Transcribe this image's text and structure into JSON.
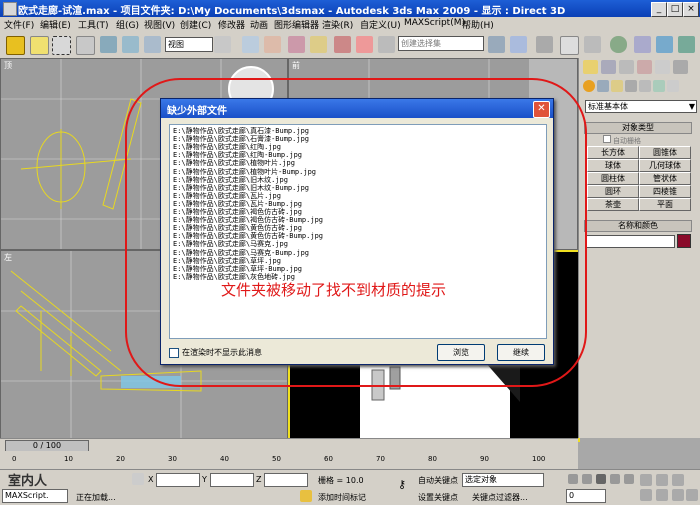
{
  "window": {
    "title": "欧式走廊-试渲.max    - 项目文件夹: D:\\My Documents\\3dsmax    - Autodesk 3ds Max  2009    - 显示 : Direct 3D"
  },
  "menu": [
    "文件(F)",
    "编辑(E)",
    "工具(T)",
    "组(G)",
    "视图(V)",
    "创建(C)",
    "修改器",
    "动画",
    "图形编辑器",
    "渲染(R)",
    "自定义(U)",
    "MAXScript(M)",
    "帮助(H)"
  ],
  "toolbar": {
    "view_dropdown": "视图",
    "selection_set_placeholder": "创建选择集"
  },
  "viewports": {
    "top": "顶",
    "front": "前",
    "left": "左"
  },
  "command_panel": {
    "category": "标准基本体",
    "rollout_object_type": "对象类型",
    "autogrid": "自动栅格",
    "buttons": [
      "长方体",
      "圆锥体",
      "球体",
      "几何球体",
      "圆柱体",
      "管状体",
      "圆环",
      "四棱锥",
      "茶壶",
      "平面"
    ],
    "rollout_name_color": "名称和颜色",
    "object_color": "#8a0a2a"
  },
  "dialog": {
    "title": "缺少外部文件",
    "close": "✕",
    "files": [
      "E:\\静物作品\\欧式走廊\\真石漆-Bump.jpg",
      "E:\\静物作品\\欧式走廊\\石膏漆-Bump.jpg",
      "E:\\静物作品\\欧式走廊\\红陶.jpg",
      "E:\\静物作品\\欧式走廊\\红陶-Bump.jpg",
      "E:\\静物作品\\欧式走廊\\植物叶片.jpg",
      "E:\\静物作品\\欧式走廊\\植物叶片-Bump.jpg",
      "E:\\静物作品\\欧式走廊\\旧木纹.jpg",
      "E:\\静物作品\\欧式走廊\\旧木纹-Bump.jpg",
      "E:\\静物作品\\欧式走廊\\瓦片.jpg",
      "E:\\静物作品\\欧式走廊\\瓦片-Bump.jpg",
      "E:\\静物作品\\欧式走廊\\褐色仿古砖.jpg",
      "E:\\静物作品\\欧式走廊\\褐色仿古砖-Bump.jpg",
      "E:\\静物作品\\欧式走廊\\黄色仿古砖.jpg",
      "E:\\静物作品\\欧式走廊\\黄色仿古砖-Bump.jpg",
      "E:\\静物作品\\欧式走廊\\马赛克.jpg",
      "E:\\静物作品\\欧式走廊\\马赛克-Bump.jpg",
      "E:\\静物作品\\欧式走廊\\草坪.jpg",
      "E:\\静物作品\\欧式走廊\\草坪-Bump.jpg",
      "E:\\静物作品\\欧式走廊\\灰色地砖.jpg"
    ],
    "annotation": "文件夹被移动了找不到材质的提示",
    "checkbox_label": "在渲染时不显示此消息",
    "browse_button": "浏览",
    "continue_button": "继续"
  },
  "timeline": {
    "slider_label": "0 / 100",
    "ticks": [
      "0",
      "10",
      "20",
      "30",
      "40",
      "50",
      "60",
      "70",
      "80",
      "90",
      "100"
    ]
  },
  "status": {
    "maxscript": "MAXScript.",
    "message": "正在加载...",
    "grid": "栅格 = 10.0",
    "auto_key": "自动关键点",
    "selected_object": "选定对象",
    "set_key": "设置关键点",
    "key_filters": "关键点过滤器...",
    "add_time_tag": "添加时间标记",
    "frame": "0",
    "watermark": "室内人",
    "coord_x_label": "X",
    "coord_y_label": "Y",
    "coord_z_label": "Z"
  }
}
